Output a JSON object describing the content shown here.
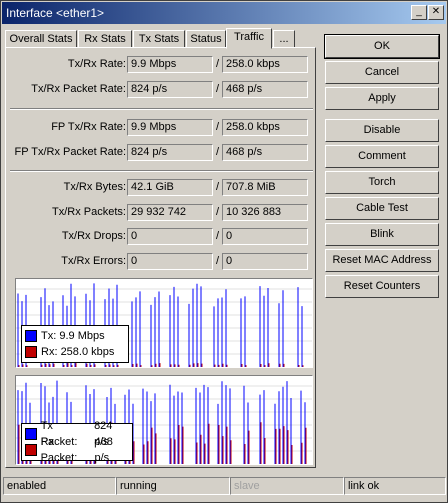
{
  "window": {
    "title": "Interface <ether1>",
    "min_label": "_",
    "close_label": "✕"
  },
  "tabs": [
    {
      "label": "Overall Stats"
    },
    {
      "label": "Rx Stats"
    },
    {
      "label": "Tx Stats"
    },
    {
      "label": "Status"
    },
    {
      "label": "Traffic"
    },
    {
      "label": "..."
    }
  ],
  "stats": {
    "tx_rx_rate": {
      "label": "Tx/Rx Rate:",
      "tx": "9.9 Mbps",
      "rx": "258.0 kbps"
    },
    "tx_rx_packet_rate": {
      "label": "Tx/Rx Packet Rate:",
      "tx": "824 p/s",
      "rx": "468 p/s"
    },
    "fp_tx_rx_rate": {
      "label": "FP Tx/Rx Rate:",
      "tx": "9.9 Mbps",
      "rx": "258.0 kbps"
    },
    "fp_tx_rx_packet_rate": {
      "label": "FP Tx/Rx Packet Rate:",
      "tx": "824 p/s",
      "rx": "468 p/s"
    },
    "tx_rx_bytes": {
      "label": "Tx/Rx Bytes:",
      "tx": "42.1 GiB",
      "rx": "707.8 MiB"
    },
    "tx_rx_packets": {
      "label": "Tx/Rx Packets:",
      "tx": "29 932 742",
      "rx": "10 326 883"
    },
    "tx_rx_drops": {
      "label": "Tx/Rx Drops:",
      "tx": "0",
      "rx": "0"
    },
    "tx_rx_errors": {
      "label": "Tx/Rx Errors:",
      "tx": "0",
      "rx": "0"
    },
    "slash": "/"
  },
  "graphs": {
    "traffic": {
      "tx_label": "Tx:",
      "tx_value": "9.9 Mbps",
      "rx_label": "Rx:",
      "rx_value": "258.0 kbps"
    },
    "packets": {
      "tx_label": "Tx Packet:",
      "tx_value": "824 p/s",
      "rx_label": "Rx Packet:",
      "rx_value": "468 p/s"
    }
  },
  "colors": {
    "tx": "#0000ff",
    "rx": "#c00000",
    "title_start": "#0a246a",
    "title_end": "#a6caf0"
  },
  "buttons": [
    {
      "label": "OK"
    },
    {
      "label": "Cancel"
    },
    {
      "label": "Apply"
    },
    {
      "label": "Disable"
    },
    {
      "label": "Comment"
    },
    {
      "label": "Torch"
    },
    {
      "label": "Cable Test"
    },
    {
      "label": "Blink"
    },
    {
      "label": "Reset MAC Address"
    },
    {
      "label": "Reset Counters"
    }
  ],
  "status_bar": [
    "enabled",
    "running",
    "slave",
    "link ok"
  ]
}
